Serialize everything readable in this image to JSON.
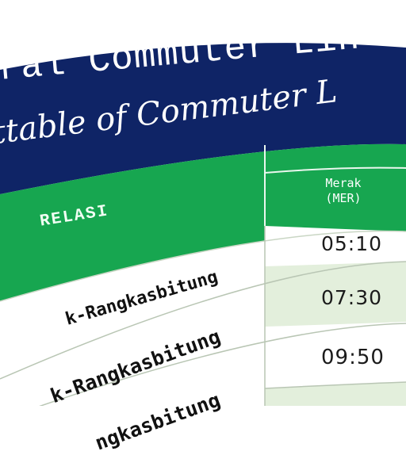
{
  "header": {
    "title": "ral Commuter Lin M",
    "subtitle": "ttable of Commuter L",
    "colors": {
      "navy": "#0f2466",
      "green": "#17a650",
      "row_tint": "#e3efdc",
      "white": "#ffffff"
    }
  },
  "table": {
    "relasi_label": "RELASI",
    "station_name": "Merak",
    "station_code": "(MER)",
    "rows": [
      {
        "route": "",
        "time": "05:10"
      },
      {
        "route": "k-Rangkasbitung",
        "time": "07:30"
      },
      {
        "route": "k-Rangkasbitung",
        "time": "09:50"
      },
      {
        "route": "ngkasbitung",
        "time": ""
      }
    ]
  }
}
